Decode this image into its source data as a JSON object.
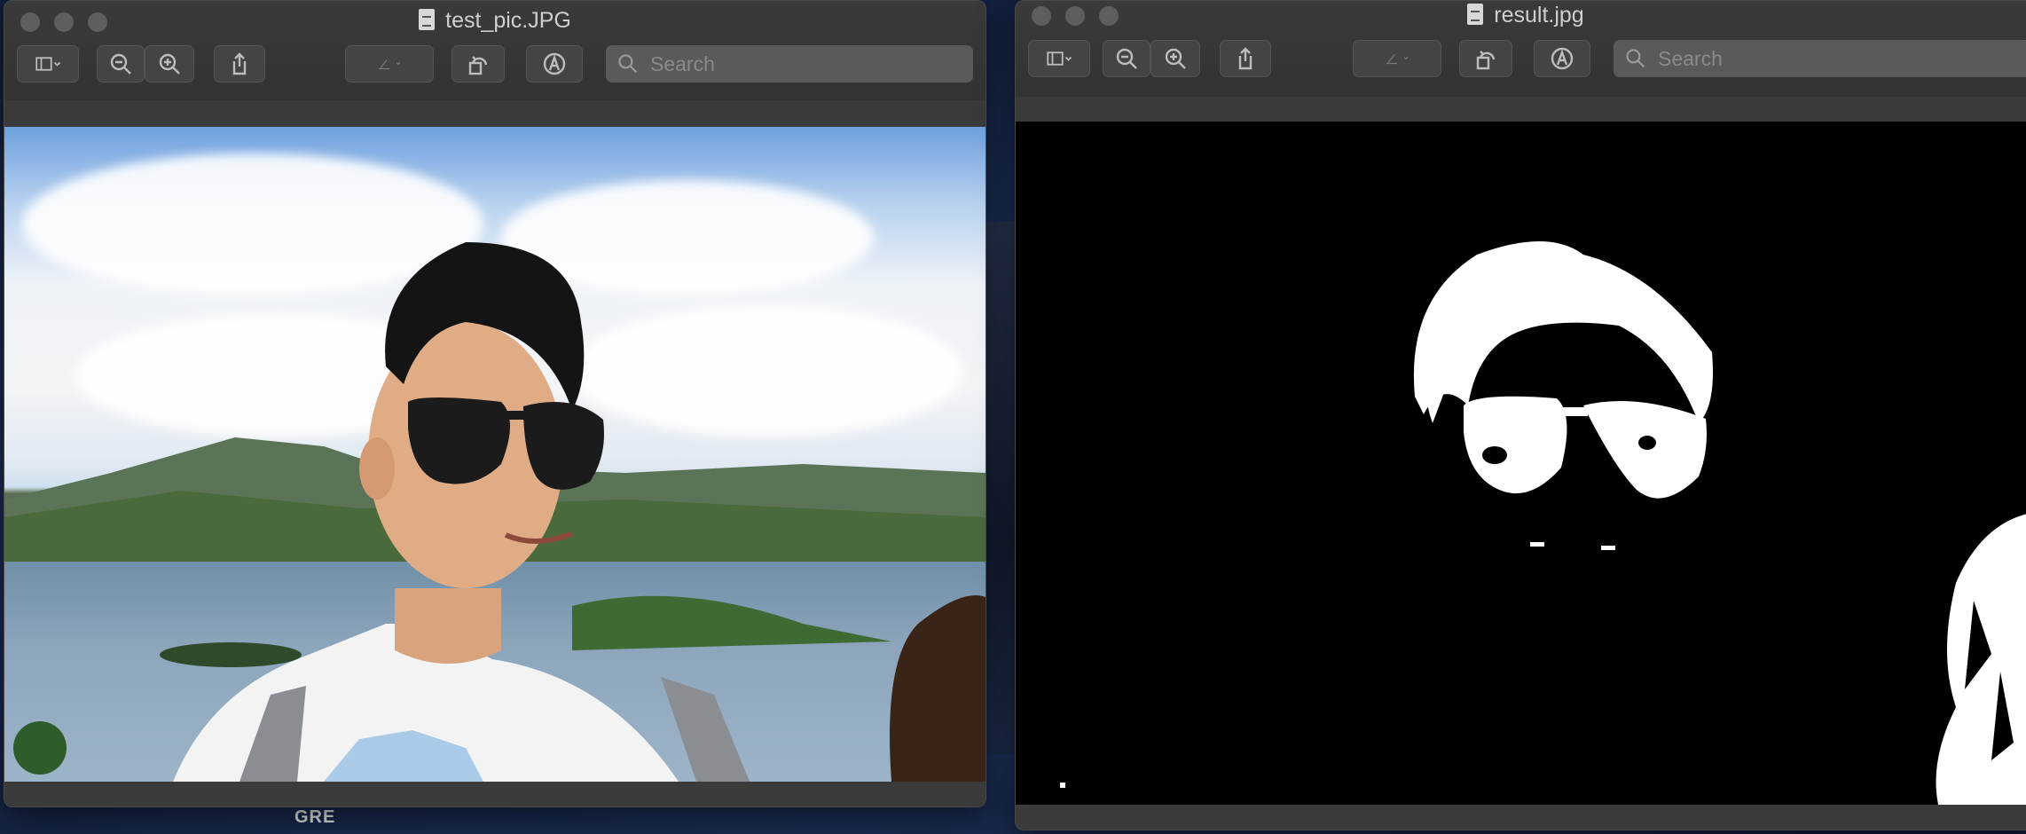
{
  "desktop": {
    "label": "GRE"
  },
  "windows": [
    {
      "title": "test_pic.JPG",
      "search_placeholder": "Search",
      "toolbar": [
        "sidebar-toggle",
        "zoom-out",
        "zoom-in",
        "share",
        "highlight",
        "rotate",
        "markup"
      ]
    },
    {
      "title": "result.jpg",
      "search_placeholder": "Search",
      "toolbar": [
        "sidebar-toggle",
        "zoom-out",
        "zoom-in",
        "share",
        "highlight",
        "rotate",
        "markup"
      ]
    }
  ]
}
